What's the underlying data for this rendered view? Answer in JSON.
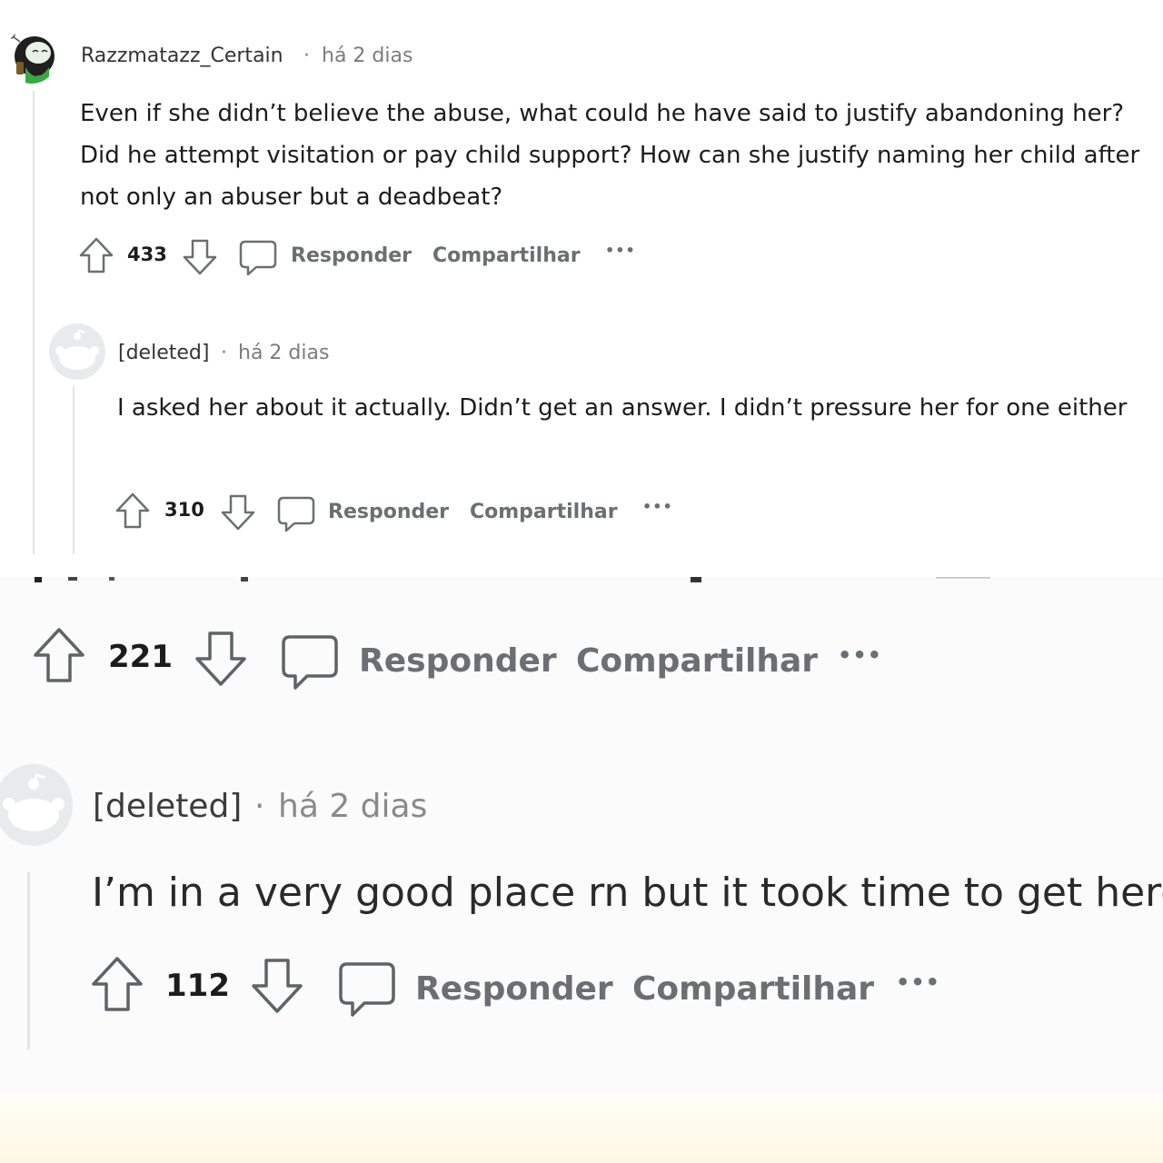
{
  "comments": [
    {
      "author": "Razzmatazz_Certain",
      "separator": "·",
      "time": "há 2 dias",
      "body": "Even if she didn’t believe the abuse, what could he have said to justify abandoning her? Did he attempt visitation or pay child support? How can she justify naming her child after not only an abuser but a deadbeat?",
      "score": "433",
      "reply_label": "Responder",
      "share_label": "Compartilhar",
      "more_label": "•••",
      "avatar_icon": "user-avatar-icon"
    },
    {
      "author": "[deleted]",
      "separator": "·",
      "time": "há 2 dias",
      "body": "I asked her about it actually. Didn’t get an answer. I didn’t pressure her for one either",
      "score": "310",
      "reply_label": "Responder",
      "share_label": "Compartilhar",
      "more_label": "•••",
      "avatar_icon": "default-avatar-icon"
    }
  ],
  "bottom_actions": {
    "score": "221",
    "reply_label": "Responder",
    "share_label": "Compartilhar",
    "more_label": "•••"
  },
  "bottom_comment": {
    "author": "[deleted]",
    "separator": "·",
    "time": "há 2 dias",
    "body": "I’m in a very good place rn but it took time to get here",
    "score": "112",
    "reply_label": "Responder",
    "share_label": "Compartilhar",
    "more_label": "•••",
    "avatar_icon": "default-avatar-icon"
  },
  "colors": {
    "text": "#1c1c1c",
    "muted": "#7c7c7c",
    "action": "#6b6f73",
    "thread_line": "#e3e5e8",
    "avatar_bg": "#e9eaec"
  }
}
